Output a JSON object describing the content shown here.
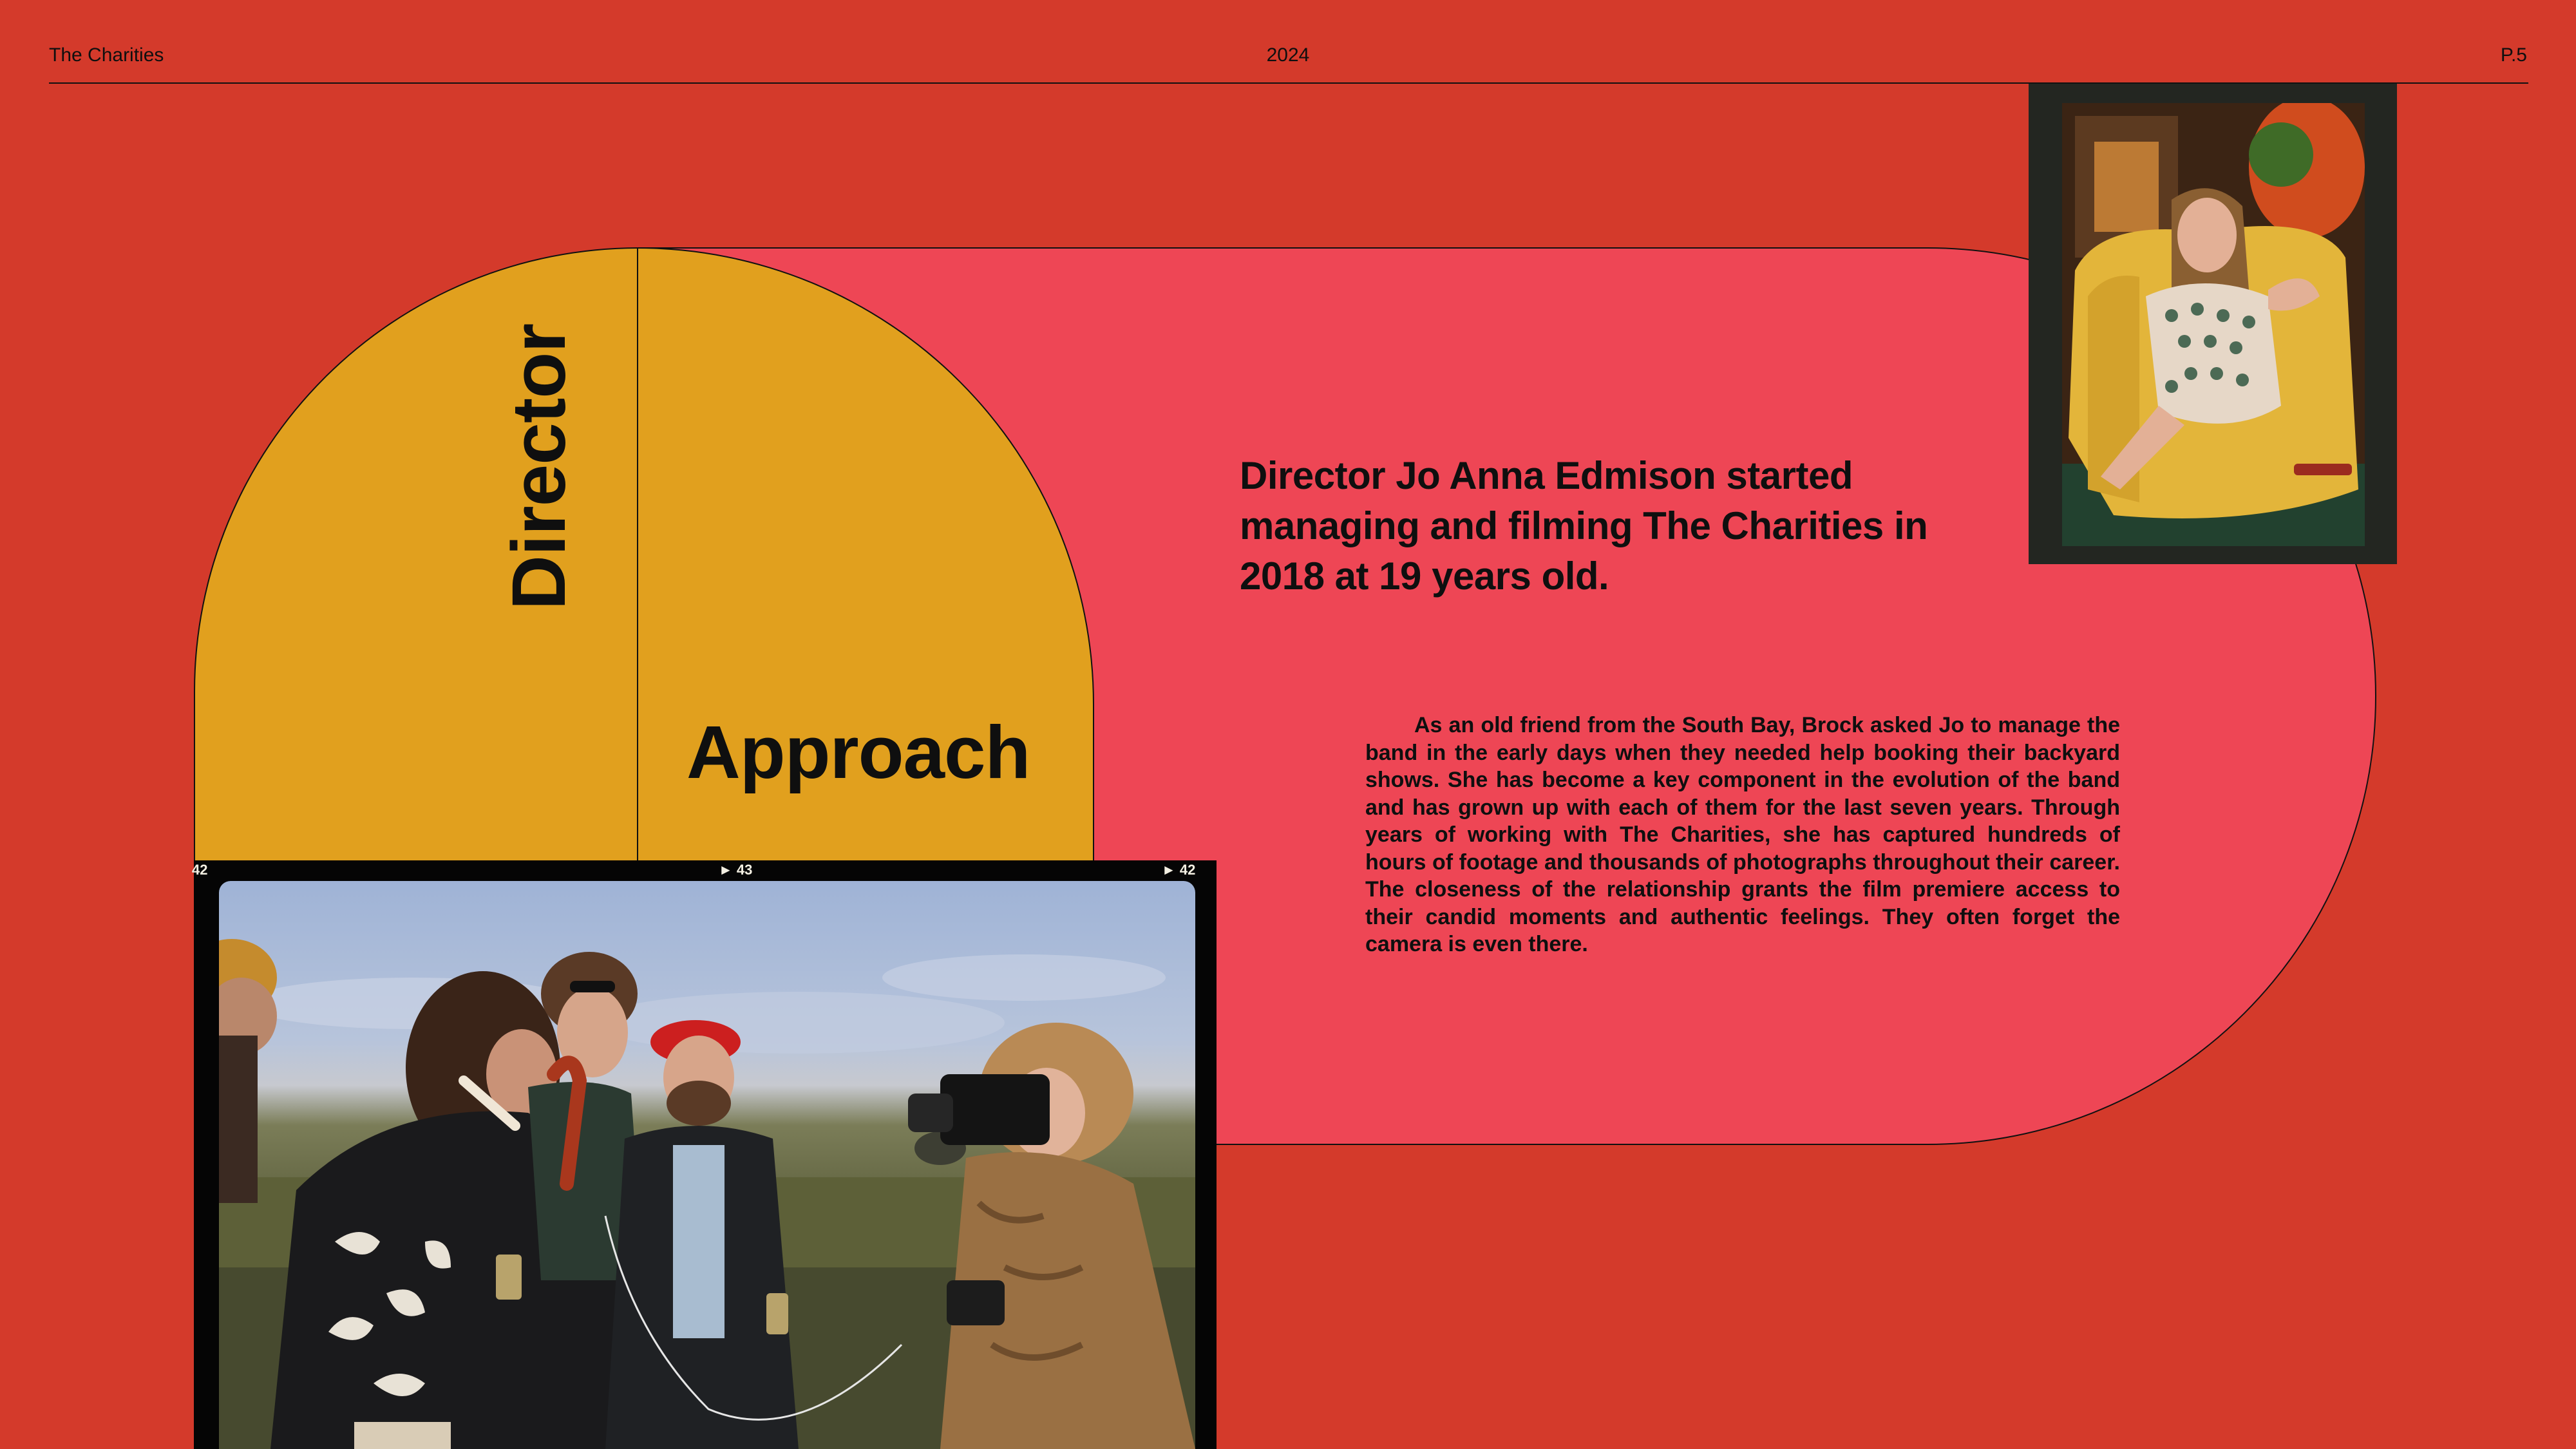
{
  "header": {
    "left": "The Charities",
    "center": "2024",
    "right": "P.5"
  },
  "section": {
    "word_vertical": "Director",
    "word_horizontal": "Approach"
  },
  "lead": "Director Jo Anna Edmison started managing and filming The Charities in 2018 at 19 years old.",
  "body": "As an old friend from the South Bay, Brock asked Jo to manage the band in the early days when they needed help booking their backyard shows. She has become a key component in the evolution of the band and has grown up with each of them for the last seven years. Through years of working with The Charities, she has captured hundreds of hours of footage and thousands of photographs throughout their career. The closeness of the relationship grants the film premiere access to their candid moments and authentic feelings. They often forget the camera is even there.",
  "film_frames": {
    "left": "42",
    "middle": "► 43",
    "right": "► 42"
  },
  "colors": {
    "background": "#d43a2b",
    "pill": "#ee4655",
    "arch": "#e1a01e",
    "text": "#0f0f0f"
  }
}
